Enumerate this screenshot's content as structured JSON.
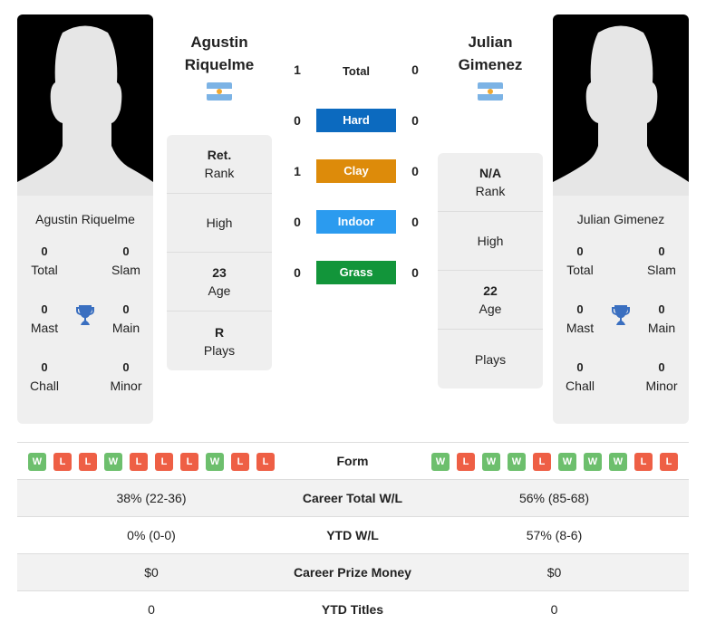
{
  "h2h": {
    "rows": [
      {
        "label": "Total",
        "left": "1",
        "right": "0",
        "color": ""
      },
      {
        "label": "Hard",
        "left": "0",
        "right": "0",
        "color": "#0c6abf"
      },
      {
        "label": "Clay",
        "left": "1",
        "right": "0",
        "color": "#dd8b0a"
      },
      {
        "label": "Indoor",
        "left": "0",
        "right": "0",
        "color": "#2b9bef"
      },
      {
        "label": "Grass",
        "left": "0",
        "right": "0",
        "color": "#12953a"
      }
    ]
  },
  "player1": {
    "first": "Agustin",
    "last": "Riquelme",
    "full": "Agustin Riquelme",
    "titles": {
      "total": "0",
      "slam": "0",
      "mast": "0",
      "main": "0",
      "chall": "0",
      "minor": "0"
    },
    "rank": "Ret.",
    "high": "",
    "age": "23",
    "plays": "R",
    "form": [
      "W",
      "L",
      "L",
      "W",
      "L",
      "L",
      "L",
      "W",
      "L",
      "L"
    ],
    "career_wl": "38% (22-36)",
    "ytd_wl": "0% (0-0)",
    "prize": "$0",
    "ytd_titles": "0"
  },
  "player2": {
    "first": "Julian",
    "last": "Gimenez",
    "full": "Julian Gimenez",
    "titles": {
      "total": "0",
      "slam": "0",
      "mast": "0",
      "main": "0",
      "chall": "0",
      "minor": "0"
    },
    "rank": "N/A",
    "high": "",
    "age": "22",
    "plays": "",
    "form": [
      "W",
      "L",
      "W",
      "W",
      "L",
      "W",
      "W",
      "W",
      "L",
      "L"
    ],
    "career_wl": "56% (85-68)",
    "ytd_wl": "57% (8-6)",
    "prize": "$0",
    "ytd_titles": "0"
  },
  "labels": {
    "total": "Total",
    "slam": "Slam",
    "mast": "Mast",
    "main": "Main",
    "chall": "Chall",
    "minor": "Minor",
    "rank": "Rank",
    "high": "High",
    "age": "Age",
    "plays": "Plays",
    "form": "Form",
    "career_wl": "Career Total W/L",
    "ytd_wl": "YTD W/L",
    "prize": "Career Prize Money",
    "ytd_titles": "YTD Titles"
  },
  "colors": {
    "win": "#6dbf6d",
    "loss": "#ee5f45",
    "trophy": "#3a6fc0"
  }
}
